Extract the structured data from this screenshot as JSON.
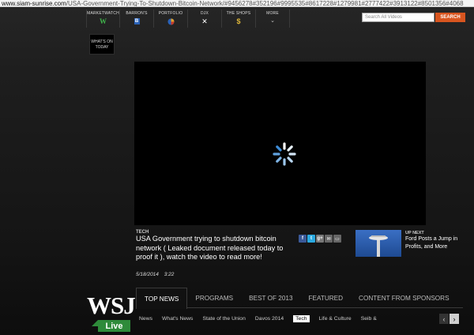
{
  "browser": {
    "url_host": "www.siam-sunrise.com",
    "url_path": "/USA-Government-Trying-To-Shutdown-Bitcoin-Network/#9456278#352196#9995535#8617228#1279981#2777422#3913122#8501356#4068"
  },
  "topnav": {
    "items": [
      {
        "label": "MARKETWATCH",
        "icon": "marketwatch-logo-icon"
      },
      {
        "label": "BARRON'S",
        "icon": "barrons-logo-icon"
      },
      {
        "label": "PORTFOLIO",
        "icon": "portfolio-pie-icon"
      },
      {
        "label": "DJX",
        "icon": "djx-x-icon"
      },
      {
        "label": "THE SHOPS",
        "icon": "shops-dollar-icon"
      },
      {
        "label": "MORE",
        "icon": "chevron-down-icon"
      }
    ],
    "search_placeholder": "Search All Videos",
    "search_button": "SEARCH"
  },
  "whats_on": "WHAT'S ON TODAY",
  "story": {
    "category": "TECH",
    "headline": "USA Government trying to shutdown bitcoin network ( Leaked document released today to proof it ), watch the video to read more!",
    "date": "5/18/2014",
    "time": "3:22"
  },
  "up_next": {
    "label": "UP NEXT",
    "title": "Ford Posts a Jump in Profits, and More"
  },
  "brand": {
    "wsj": "WSJ",
    "live": "Live",
    "live_color": "#2e8b3a"
  },
  "tabs": [
    "TOP NEWS",
    "PROGRAMS",
    "BEST OF 2013",
    "FEATURED",
    "CONTENT FROM SPONSORS"
  ],
  "subnav": [
    "News",
    "What's News",
    "State of the Union",
    "Davos 2014",
    "Tech",
    "Life & Culture",
    "Seib &"
  ],
  "colors": {
    "accent": "#d8551f",
    "background": "#1a1a1a"
  }
}
